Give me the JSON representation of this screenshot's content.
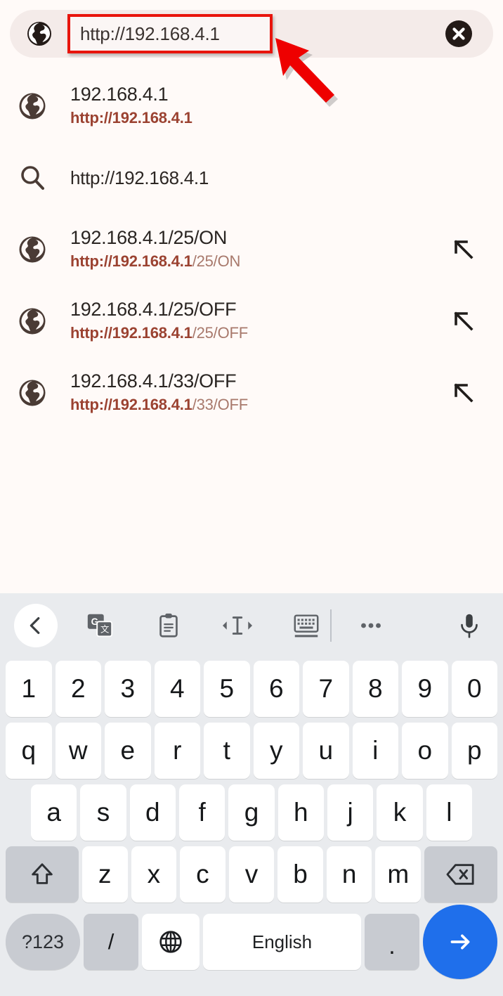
{
  "urlbar": {
    "icon": "globe-icon",
    "value": "http://192.168.4.1",
    "clear_icon": "close-circle-icon",
    "highlight_color": "#E8140C",
    "background": "#F4EBE9"
  },
  "annotation": {
    "type": "arrow",
    "color": "#EE0000",
    "points_to": "url-input-field"
  },
  "suggestions": [
    {
      "icon": "globe-icon",
      "title": "192.168.4.1",
      "url_strong": "http://192.168.4.1",
      "url_weak": "",
      "has_fill_arrow": false
    },
    {
      "icon": "search-icon",
      "title": "http://192.168.4.1",
      "url_strong": "",
      "url_weak": "",
      "has_fill_arrow": false
    },
    {
      "icon": "globe-icon",
      "title": "192.168.4.1/25/ON",
      "url_strong": "http://192.168.4.1",
      "url_weak": "/25/ON",
      "has_fill_arrow": true
    },
    {
      "icon": "globe-icon",
      "title": "192.168.4.1/25/OFF",
      "url_strong": "http://192.168.4.1",
      "url_weak": "/25/OFF",
      "has_fill_arrow": true
    },
    {
      "icon": "globe-icon",
      "title": "192.168.4.1/33/OFF",
      "url_strong": "http://192.168.4.1",
      "url_weak": "/33/OFF",
      "has_fill_arrow": true
    }
  ],
  "keyboard": {
    "background": "#E9EBEE",
    "toolbar": [
      {
        "name": "back-chevron-icon",
        "label": ""
      },
      {
        "name": "google-translate-icon",
        "label": ""
      },
      {
        "name": "clipboard-icon",
        "label": ""
      },
      {
        "name": "text-cursor-icon",
        "label": ""
      },
      {
        "name": "keyboard-settings-icon",
        "label": ""
      },
      {
        "name": "more-options-icon",
        "label": ""
      },
      {
        "name": "microphone-icon",
        "label": ""
      }
    ],
    "row_numbers": [
      "1",
      "2",
      "3",
      "4",
      "5",
      "6",
      "7",
      "8",
      "9",
      "0"
    ],
    "row_top": [
      "q",
      "w",
      "e",
      "r",
      "t",
      "y",
      "u",
      "i",
      "o",
      "p"
    ],
    "row_home": [
      "a",
      "s",
      "d",
      "f",
      "g",
      "h",
      "j",
      "k",
      "l"
    ],
    "row_bottom": [
      "z",
      "x",
      "c",
      "v",
      "b",
      "n",
      "m"
    ],
    "shift_key": "shift-icon",
    "backspace_key": "backspace-icon",
    "symbols_key": "?123",
    "slash_key": "/",
    "language_key": "globe-icon",
    "space_key": "English",
    "period_key": ".",
    "enter_key": "arrow-right-icon",
    "enter_color": "#1F6FEB"
  }
}
